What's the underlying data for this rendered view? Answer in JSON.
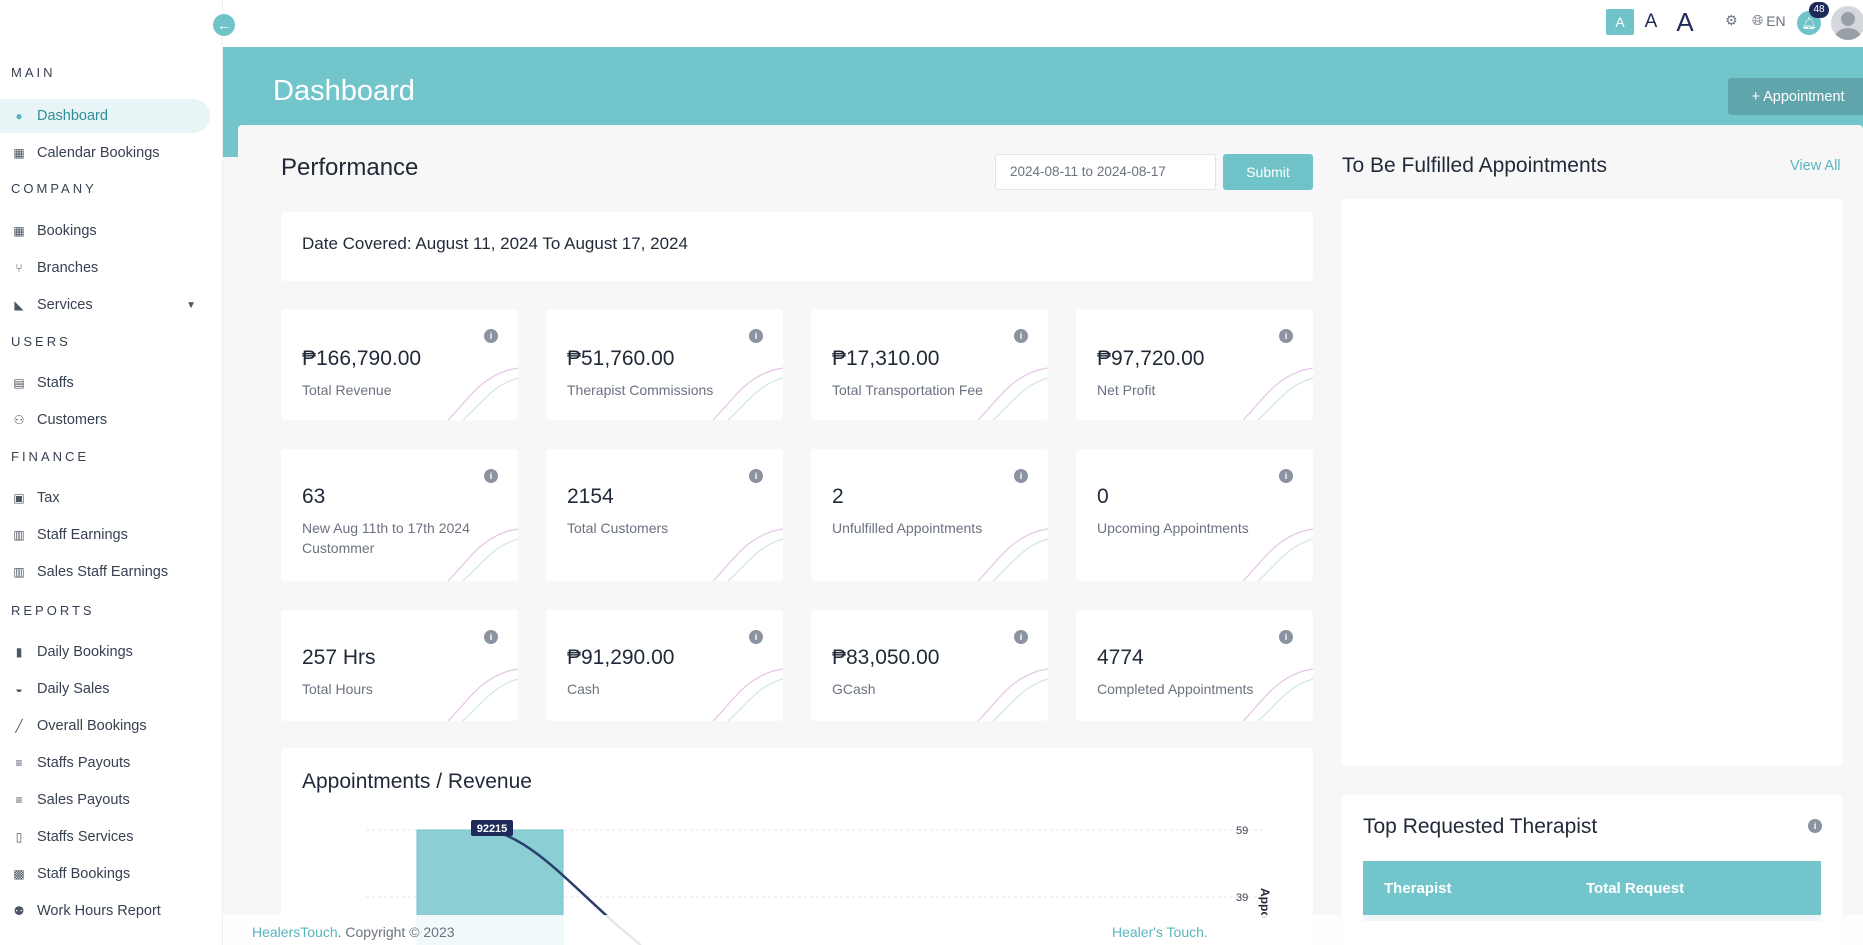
{
  "sidebar": {
    "sections": [
      {
        "title": "MAIN",
        "items": [
          {
            "label": "Dashboard",
            "icon": "dashboard-icon",
            "active": true
          },
          {
            "label": "Calendar Bookings",
            "icon": "calendar-icon"
          }
        ]
      },
      {
        "title": "COMPANY",
        "items": [
          {
            "label": "Bookings",
            "icon": "calendar-icon"
          },
          {
            "label": "Branches",
            "icon": "branch-icon"
          },
          {
            "label": "Services",
            "icon": "spa-icon",
            "has_submenu": true
          }
        ]
      },
      {
        "title": "USERS",
        "items": [
          {
            "label": "Staffs",
            "icon": "id-card-icon"
          },
          {
            "label": "Customers",
            "icon": "users-icon"
          }
        ]
      },
      {
        "title": "FINANCE",
        "items": [
          {
            "label": "Tax",
            "icon": "tax-icon"
          },
          {
            "label": "Staff Earnings",
            "icon": "money-icon"
          },
          {
            "label": "Sales Staff Earnings",
            "icon": "money-icon"
          }
        ]
      },
      {
        "title": "REPORTS",
        "items": [
          {
            "label": "Daily Bookings",
            "icon": "file-icon"
          },
          {
            "label": "Daily Sales",
            "icon": "hand-coin-icon"
          },
          {
            "label": "Overall Bookings",
            "icon": "line-chart-icon"
          },
          {
            "label": "Staffs Payouts",
            "icon": "bar-chart-icon"
          },
          {
            "label": "Sales Payouts",
            "icon": "bar-chart-icon"
          },
          {
            "label": "Staffs Services",
            "icon": "clipboard-icon"
          },
          {
            "label": "Staff Bookings",
            "icon": "address-book-icon"
          },
          {
            "label": "Work Hours Report",
            "icon": "user-clock-icon"
          }
        ]
      }
    ]
  },
  "topbar": {
    "font_small": "A",
    "font_medium": "A",
    "font_large": "A",
    "language": "EN",
    "notification_count": "48"
  },
  "header": {
    "title": "Dashboard",
    "appointment_button": "+ Appointment"
  },
  "performance": {
    "title": "Performance",
    "date_range_value": "2024-08-11 to 2024-08-17",
    "submit_label": "Submit",
    "date_covered": "Date Covered: August 11, 2024 To August 17, 2024",
    "stats": [
      {
        "value": "₱166,790.00",
        "label": "Total Revenue"
      },
      {
        "value": "₱51,760.00",
        "label": "Therapist Commissions"
      },
      {
        "value": "₱17,310.00",
        "label": "Total Transportation Fee"
      },
      {
        "value": "₱97,720.00",
        "label": "Net Profit"
      },
      {
        "value": "63",
        "label": "New Aug 11th to 17th 2024 Custommer"
      },
      {
        "value": "2154",
        "label": "Total Customers"
      },
      {
        "value": "2",
        "label": "Unfulfilled Appointments"
      },
      {
        "value": "0",
        "label": "Upcoming Appointments"
      },
      {
        "value": "257 Hrs",
        "label": "Total Hours"
      },
      {
        "value": "₱91,290.00",
        "label": "Cash"
      },
      {
        "value": "₱83,050.00",
        "label": "GCash"
      },
      {
        "value": "4774",
        "label": "Completed Appointments"
      }
    ]
  },
  "appointments_revenue": {
    "title": "Appointments / Revenue",
    "chart_data": {
      "type": "bar",
      "bar_data_label": "92215",
      "right_axis_ticks": [
        "59",
        "39"
      ],
      "right_axis_label": "Appo",
      "values": [
        92215
      ]
    }
  },
  "fulfilled": {
    "title": "To Be Fulfilled Appointments",
    "view_all": "View All"
  },
  "top_therapist": {
    "title": "Top Requested Therapist",
    "columns": [
      "Therapist",
      "Total Request"
    ]
  },
  "footer": {
    "brand": "HealersTouch",
    "copyright": ". Copyright © 2023",
    "right_text": "Healer's Touch."
  },
  "colors": {
    "accent": "#72c5cb",
    "accent_dark": "#5fa5ab",
    "link": "#58b6be"
  }
}
